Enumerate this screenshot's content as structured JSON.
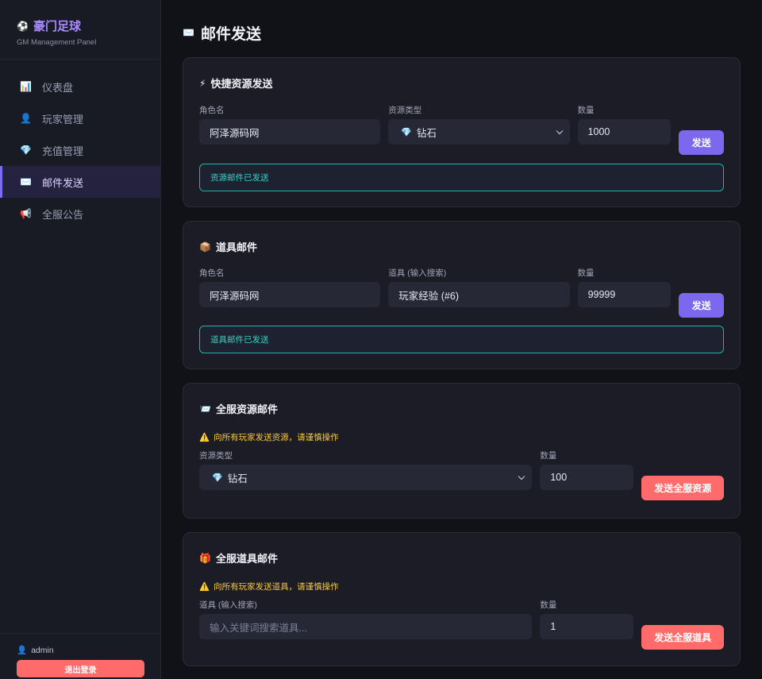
{
  "brand": {
    "title": "豪门足球",
    "subtitle": "GM Management Panel",
    "icon": "soccer-ball-icon"
  },
  "nav": [
    {
      "label": "仪表盘",
      "icon": "📊",
      "icon_name": "bar-chart-icon",
      "active": false
    },
    {
      "label": "玩家管理",
      "icon": "👤",
      "icon_name": "player-icon",
      "active": false
    },
    {
      "label": "充值管理",
      "icon": "💎",
      "icon_name": "diamond-icon",
      "active": false
    },
    {
      "label": "邮件发送",
      "icon": "✉️",
      "icon_name": "envelope-icon",
      "active": true
    },
    {
      "label": "全服公告",
      "icon": "📢",
      "icon_name": "megaphone-icon",
      "active": false
    }
  ],
  "footer": {
    "user": "admin",
    "logout": "退出登录"
  },
  "page": {
    "title": "邮件发送",
    "icon": "✉️"
  },
  "quick": {
    "title": "快捷资源发送",
    "icon": "⚡",
    "role_label": "角色名",
    "role_value": "阿泽源码网",
    "type_label": "资源类型",
    "type_value": "钻石",
    "type_icon": "💎",
    "qty_label": "数量",
    "qty_value": "1000",
    "button": "发送",
    "status": "资源邮件已发送"
  },
  "item": {
    "title": "道具邮件",
    "icon": "📦",
    "role_label": "角色名",
    "role_value": "阿泽源码网",
    "item_label": "道具 (输入搜索)",
    "item_value": "玩家经验 (#6)",
    "qty_label": "数量",
    "qty_value": "99999",
    "button": "发送",
    "status": "道具邮件已发送"
  },
  "all_resource": {
    "title": "全服资源邮件",
    "icon": "📨",
    "warning": "向所有玩家发送资源，请谨慎操作",
    "warn_icon": "⚠️",
    "type_label": "资源类型",
    "type_value": "钻石",
    "type_icon": "💎",
    "qty_label": "数量",
    "qty_value": "100",
    "button": "发送全服资源"
  },
  "all_item": {
    "title": "全服道具邮件",
    "icon": "🎁",
    "warning": "向所有玩家发送道具，请谨慎操作",
    "warn_icon": "⚠️",
    "item_label": "道具 (输入搜索)",
    "item_placeholder": "输入关键词搜索道具...",
    "qty_label": "数量",
    "qty_value": "1",
    "button": "发送全服道具"
  },
  "colors": {
    "accent": "#7b68ee",
    "danger": "#ff6b6b",
    "success": "#34d3c6",
    "warning": "#f5c842"
  }
}
